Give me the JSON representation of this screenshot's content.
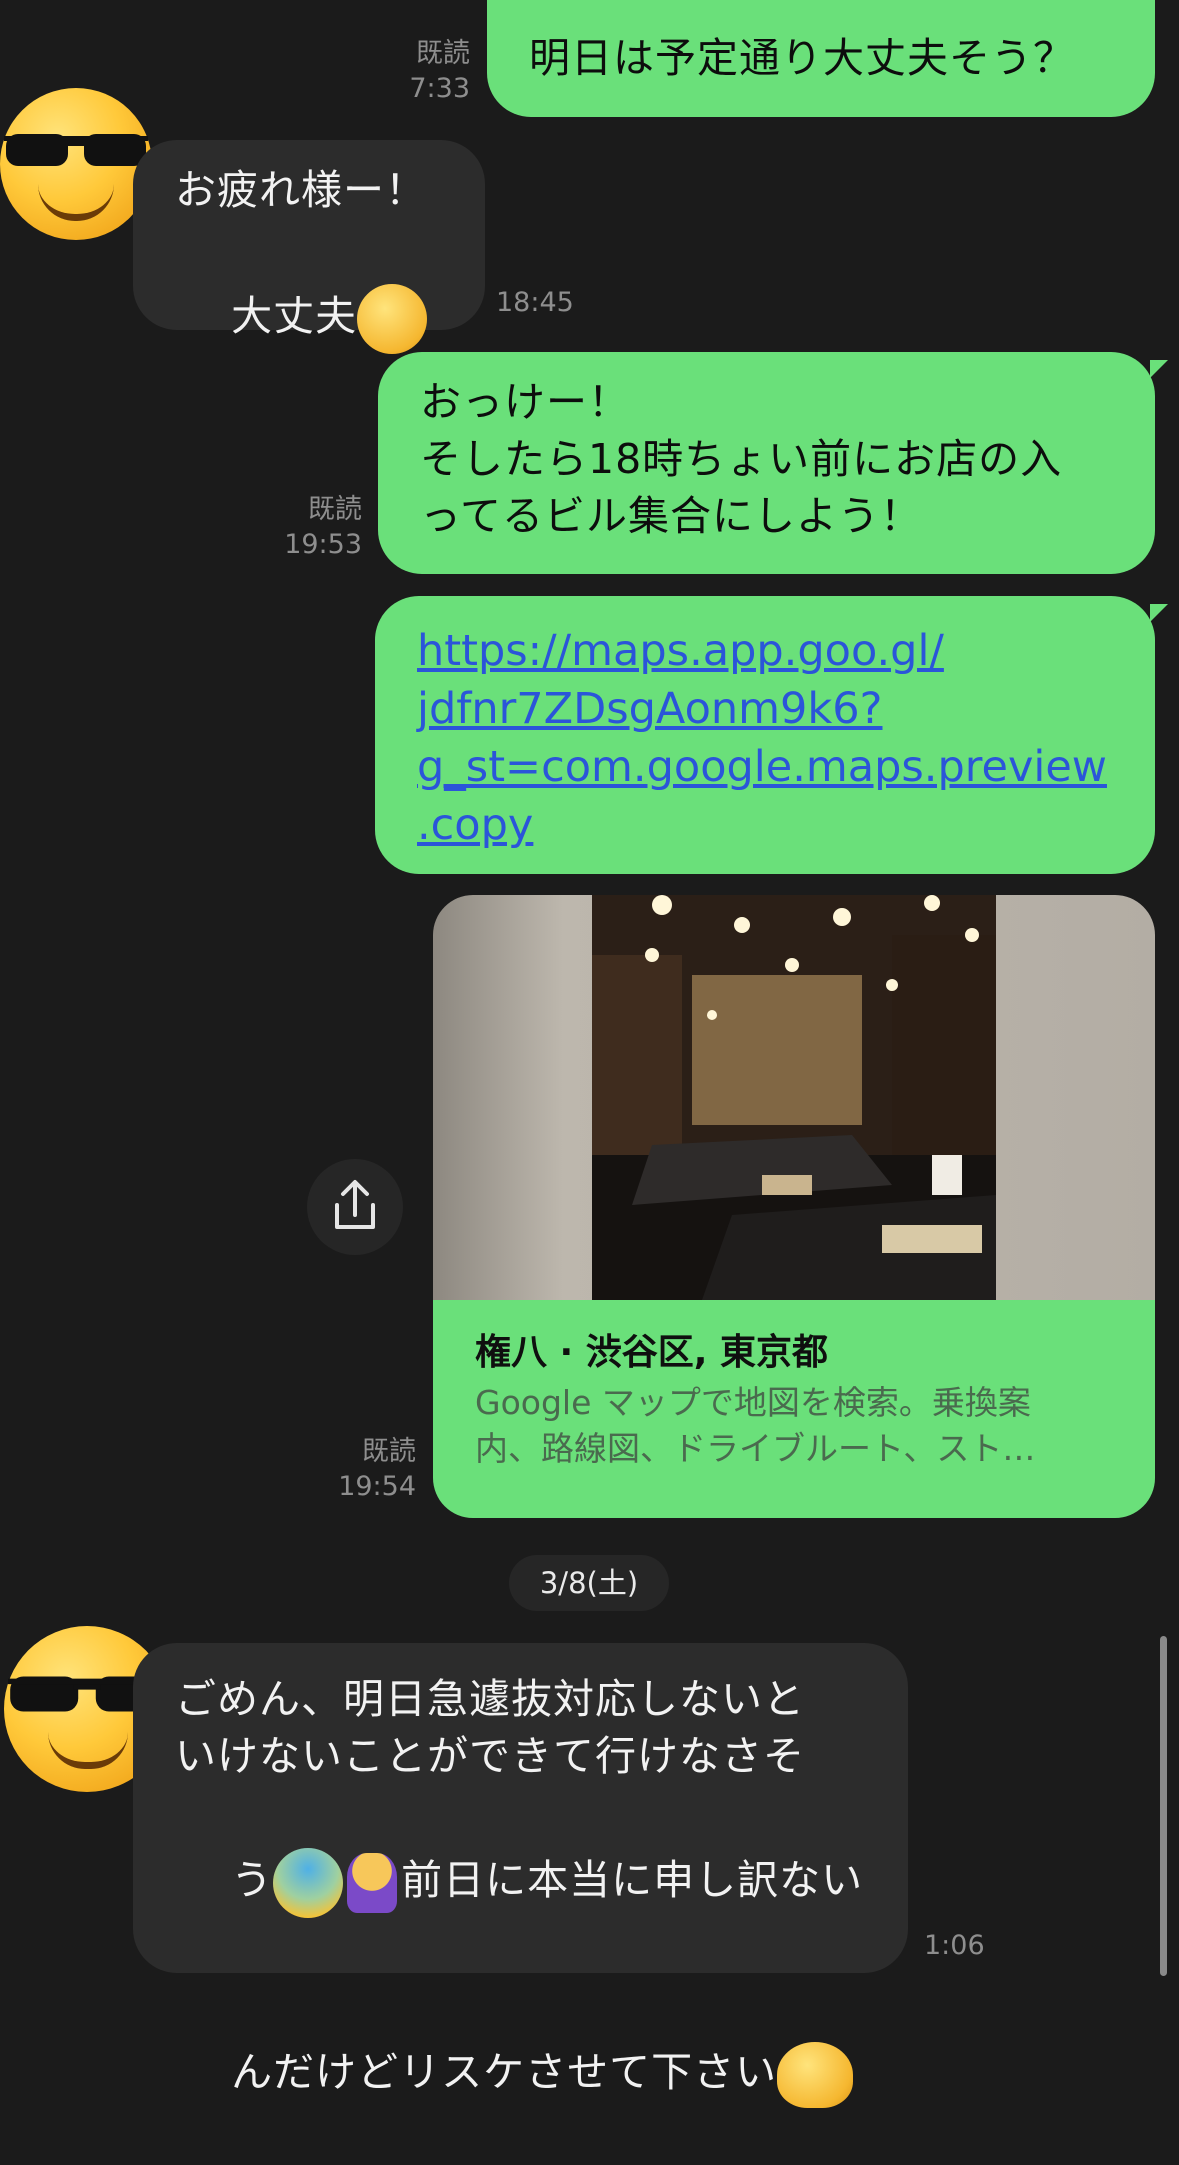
{
  "messages": [
    {
      "side": "me",
      "read": "既読",
      "time": "7:33",
      "text": "明日は予定通り大丈夫そう？"
    },
    {
      "side": "them",
      "time": "18:45",
      "line1": "お疲れ様ー！",
      "line2": "大丈夫"
    },
    {
      "side": "me",
      "read": "既読",
      "time": "19:53",
      "line1": "おっけー！",
      "line2": "そしたら18時ちょい前にお店の入",
      "line3": "ってるビル集合にしよう！"
    },
    {
      "side": "me",
      "link_lines": [
        "https://maps.app.goo.gl/",
        "jdfnr7ZDsgAonm9k6?",
        "g_st=com.google.maps.preview",
        ".copy"
      ]
    },
    {
      "side": "me",
      "read": "既読",
      "time": "19:54",
      "card": {
        "title": "権八 · 渋谷区, 東京都",
        "desc1": "Google マップで地図を検索。乗換案",
        "desc2": "内、路線図、ドライブルート、スト…"
      }
    },
    {
      "side": "them",
      "time": "1:06",
      "line1": "ごめん、明日急遽抜対応しないと",
      "line2": "いけないことができて行けなさそ",
      "line3a": "う",
      "line3b": "前日に本当に申し訳ない",
      "line4": "んだけどリスケさせて下さい"
    }
  ],
  "date_separator": "3/8(土)",
  "icons": {
    "share": "share-icon",
    "avatar": "sunglasses-face-avatar"
  },
  "colors": {
    "bubble_me": "#6ae07a",
    "bubble_them": "#2c2c2c",
    "background": "#1b1b1b",
    "link": "#2b55d9"
  }
}
